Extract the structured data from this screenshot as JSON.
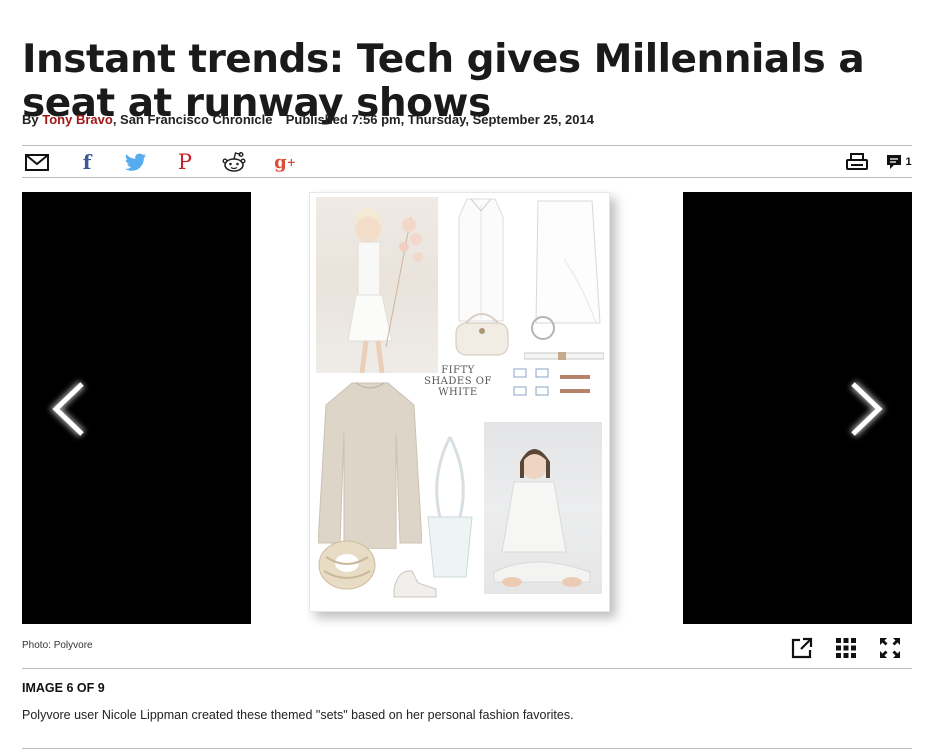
{
  "article": {
    "headline": "Instant trends: Tech gives Millennials a seat at runway shows",
    "byline_prefix": "By",
    "author": "Tony Bravo",
    "publication": ", San Francisco Chronicle",
    "published": "Published 7:56 pm, Thursday, September 25, 2014"
  },
  "share": {
    "icons": [
      "email-icon",
      "facebook-icon",
      "twitter-icon",
      "pinterest-icon",
      "reddit-icon",
      "google-plus-icon"
    ],
    "facebook_glyph": "f",
    "pinterest_glyph": "P",
    "google_plus_glyph": "g",
    "google_plus_sup": "+",
    "comment_count": "1",
    "colors": {
      "facebook": "#3b5998",
      "twitter": "#55acee",
      "pinterest": "#cb2027",
      "google_plus": "#dd4b39",
      "author": "#a01818"
    }
  },
  "gallery": {
    "collage_text": [
      "FIFTY",
      "SHADES OF",
      "WHITE"
    ],
    "photo_credit": "Photo: Polyvore",
    "image_count": "IMAGE 6 OF 9",
    "caption": "Polyvore user Nicole Lippman created these themed \"sets\" based on her personal fashion favorites."
  }
}
